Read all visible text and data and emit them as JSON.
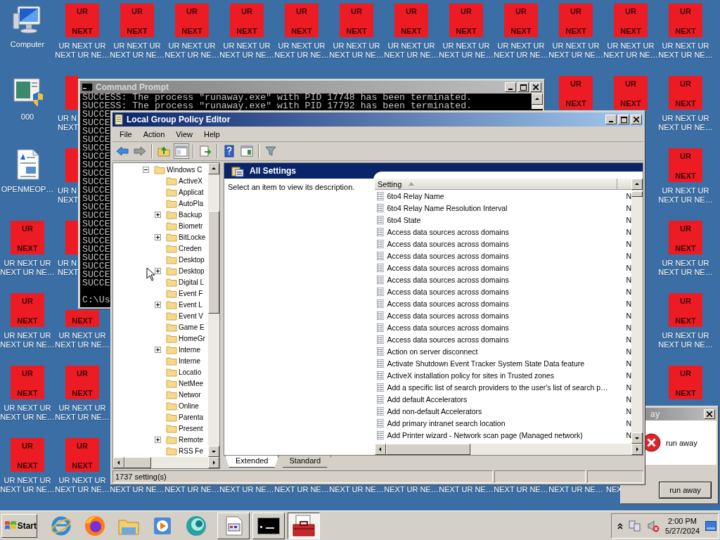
{
  "desktop": {
    "columns": [
      {
        "icons": [
          {
            "kind": "computer",
            "label": {
              "first": "Computer"
            }
          },
          {
            "kind": "panel",
            "label": {
              "first": "000"
            }
          },
          {
            "kind": "document",
            "label": {
              "first": "OPENMEOP…"
            }
          },
          {
            "kind": "tile",
            "tile": {
              "top": "UR",
              "bottom": "NEXT"
            },
            "label": {
              "first": "UR NEXT UR",
              "second": "NEXT UR NE…"
            }
          },
          {
            "kind": "tile",
            "tile": {
              "top": "UR",
              "bottom": "NEXT"
            },
            "label": {
              "first": "UR NEXT UR",
              "second": "NEXT UR NE…"
            }
          },
          {
            "kind": "tile",
            "tile": {
              "top": "UR",
              "bottom": "NEXT"
            },
            "label": {
              "first": "UR NEXT UR",
              "second": "NEXT UR NE…"
            }
          },
          {
            "kind": "tile",
            "tile": {
              "top": "UR",
              "bottom": "NEXT"
            },
            "label": {
              "first": "UR NEXT UR",
              "second": "NEXT UR NE…"
            }
          }
        ]
      },
      {
        "icons": [
          {
            "kind": "tile",
            "tile": {
              "top": "UR",
              "bottom": "NEXT"
            },
            "label": {
              "first": "UR NEXT UR",
              "second": "NEXT UR NE…"
            }
          },
          {
            "kind": "tile_sliver",
            "label": {
              "first": "UR N",
              "second": "NEXT"
            }
          },
          {
            "kind": "tile_sliver",
            "label": {
              "first": "UR N",
              "second": "NEXT"
            }
          },
          {
            "kind": "tile_sliver",
            "label": {
              "first": "UR N",
              "second": "NEXT"
            }
          },
          {
            "kind": "tile",
            "tile": {
              "bottom": "NEXT"
            },
            "label": {
              "first": "UR NEXT UR",
              "second": "NEXT UR NE…"
            }
          },
          {
            "kind": "tile",
            "tile": {
              "top": "UR",
              "bottom": "NEXT"
            },
            "label": {
              "first": "UR NEXT UR",
              "second": "NEXT UR NE…"
            }
          },
          {
            "kind": "tile",
            "tile": {
              "top": "UR",
              "bottom": "NEXT"
            },
            "label": {
              "first": "UR NEXT UR",
              "second": "NEXT UR NE…"
            }
          }
        ]
      },
      {
        "icons": [
          {
            "kind": "tile",
            "tile": {
              "top": "UR",
              "bottom": "NEXT"
            },
            "label": {
              "first": "UR NEXT UR",
              "second": "NEXT UR NE…"
            }
          },
          {
            "kind": "covered"
          },
          {
            "kind": "covered"
          },
          {
            "kind": "covered"
          },
          {
            "kind": "covered"
          },
          {
            "kind": "covered"
          },
          {
            "kind": "label_only",
            "label": {
              "second": "NEXT UR NE…"
            }
          }
        ]
      },
      {
        "icons": [
          {
            "kind": "tile",
            "tile": {
              "top": "UR",
              "bottom": "NEXT"
            },
            "label": {
              "first": "UR NEXT UR",
              "second": "NEXT UR NE…"
            }
          },
          {
            "kind": "covered"
          },
          {
            "kind": "covered"
          },
          {
            "kind": "covered"
          },
          {
            "kind": "covered"
          },
          {
            "kind": "covered"
          },
          {
            "kind": "label_only",
            "label": {
              "second": "NEXT UR NE…"
            }
          }
        ]
      },
      {
        "icons": [
          {
            "kind": "tile",
            "tile": {
              "top": "UR",
              "bottom": "NEXT"
            },
            "label": {
              "first": "UR NEXT UR",
              "second": "NEXT UR NE…"
            }
          },
          {
            "kind": "covered"
          },
          {
            "kind": "covered"
          },
          {
            "kind": "covered"
          },
          {
            "kind": "covered"
          },
          {
            "kind": "covered"
          },
          {
            "kind": "label_only",
            "label": {
              "second": "NEXT UR NE…"
            }
          }
        ]
      },
      {
        "icons": [
          {
            "kind": "tile",
            "tile": {
              "top": "UR",
              "bottom": "NEXT"
            },
            "label": {
              "first": "UR NEXT UR",
              "second": "NEXT UR NE…"
            }
          },
          {
            "kind": "covered"
          },
          {
            "kind": "covered"
          },
          {
            "kind": "covered"
          },
          {
            "kind": "covered"
          },
          {
            "kind": "covered"
          },
          {
            "kind": "label_only",
            "label": {
              "second": "NEXT UR NE…"
            }
          }
        ]
      },
      {
        "icons": [
          {
            "kind": "tile",
            "tile": {
              "top": "UR",
              "bottom": "NEXT"
            },
            "label": {
              "first": "UR NEXT UR",
              "second": "NEXT UR NE…"
            }
          },
          {
            "kind": "covered"
          },
          {
            "kind": "covered"
          },
          {
            "kind": "covered"
          },
          {
            "kind": "covered"
          },
          {
            "kind": "covered"
          },
          {
            "kind": "label_only",
            "label": {
              "second": "NEXT UR NE…"
            }
          }
        ]
      },
      {
        "icons": [
          {
            "kind": "tile",
            "tile": {
              "top": "UR",
              "bottom": "NEXT"
            },
            "label": {
              "first": "UR NEXT UR",
              "second": "NEXT UR NE…"
            }
          },
          {
            "kind": "covered"
          },
          {
            "kind": "covered"
          },
          {
            "kind": "covered"
          },
          {
            "kind": "covered"
          },
          {
            "kind": "covered"
          },
          {
            "kind": "label_only",
            "label": {
              "second": "NEXT UR NE…"
            }
          }
        ]
      },
      {
        "icons": [
          {
            "kind": "tile",
            "tile": {
              "top": "UR",
              "bottom": "NEXT"
            },
            "label": {
              "first": "UR NEXT UR",
              "second": "NEXT UR NE…"
            }
          },
          {
            "kind": "covered"
          },
          {
            "kind": "covered"
          },
          {
            "kind": "covered"
          },
          {
            "kind": "covered"
          },
          {
            "kind": "covered"
          },
          {
            "kind": "label_only",
            "label": {
              "second": "NEXT UR NE…"
            }
          }
        ]
      },
      {
        "icons": [
          {
            "kind": "tile",
            "tile": {
              "top": "UR",
              "bottom": "NEXT"
            },
            "label": {
              "first": "UR NEXT UR",
              "second": "NEXT UR NE…"
            }
          },
          {
            "kind": "covered"
          },
          {
            "kind": "covered"
          },
          {
            "kind": "covered"
          },
          {
            "kind": "covered"
          },
          {
            "kind": "covered"
          },
          {
            "kind": "label_only",
            "label": {
              "second": "NEXT UR NE…"
            }
          }
        ]
      },
      {
        "icons": [
          {
            "kind": "tile",
            "tile": {
              "top": "UR",
              "bottom": "NEXT"
            },
            "label": {
              "first": "UR NEXT UR",
              "second": "NEXT UR NE…"
            }
          },
          {
            "kind": "tile",
            "tile": {
              "top": "UR",
              "bottom": "NEXT"
            }
          },
          {
            "kind": "covered"
          },
          {
            "kind": "covered"
          },
          {
            "kind": "covered"
          },
          {
            "kind": "covered"
          },
          {
            "kind": "label_only",
            "label": {
              "second": "NEXT UR NE…"
            }
          }
        ]
      },
      {
        "icons": [
          {
            "kind": "tile",
            "tile": {
              "top": "UR",
              "bottom": "NEXT"
            },
            "label": {
              "first": "UR NEXT UR",
              "second": "NEXT UR NE…"
            }
          },
          {
            "kind": "tile",
            "tile": {
              "top": "UR",
              "bottom": "NEXT"
            }
          },
          {
            "kind": "covered"
          },
          {
            "kind": "covered"
          },
          {
            "kind": "covered"
          },
          {
            "kind": "covered"
          },
          {
            "kind": "label_tail",
            "label": {
              "second": "NEX"
            }
          }
        ]
      },
      {
        "icons": [
          {
            "kind": "tile",
            "tile": {
              "top": "UR",
              "bottom": "NEXT"
            },
            "label": {
              "first": "UR NEXT UR",
              "second": "NEXT UR NE…"
            }
          },
          {
            "kind": "tile",
            "tile": {
              "top": "UR",
              "bottom": "NEXT"
            },
            "label": {
              "first": "UR NEXT UR",
              "second": "NEXT UR NE…"
            }
          },
          {
            "kind": "tile",
            "tile": {
              "top": "UR",
              "bottom": "NEXT"
            },
            "label": {
              "first": "UR NEXT UR",
              "second": "NEXT UR NE…"
            }
          },
          {
            "kind": "tile",
            "tile": {
              "top": "UR",
              "bottom": "NEXT"
            },
            "label": {
              "first": "UR NEXT UR",
              "second": "NEXT UR NE…"
            }
          },
          {
            "kind": "tile",
            "tile": {
              "top": "UR",
              "bottom": "NEXT"
            },
            "label": {
              "first": "UR NEXT UR",
              "second": "NEXT UR NE…"
            }
          },
          {
            "kind": "tile",
            "tile": {
              "top": "UR",
              "bottom": "NEXT"
            }
          },
          {
            "kind": "covered"
          }
        ]
      }
    ]
  },
  "command_prompt": {
    "title": "Command Prompt",
    "lines": [
      "SUCCESS: The process \"runaway.exe\" with PID 17748 has been terminated.",
      "SUCCESS: The process \"runaway.exe\" with PID 17792 has been terminated.",
      "SUCCE",
      "SUCCE",
      "SUCCE",
      "SUCCE",
      "SUCCE",
      "SUCCE",
      "SUCCE",
      "SUCCE",
      "SUCCE",
      "SUCCE",
      "SUCCE",
      "SUCCE",
      "SUCCE",
      "SUCCE",
      "SUCCE",
      "SUCCE",
      "SUCCE",
      "SUCCE",
      "SUCCE",
      "SUCCE",
      "SUCCE"
    ],
    "prompt": "C:\\Us"
  },
  "group_policy_editor": {
    "title": "Local Group Policy Editor",
    "menu": [
      "File",
      "Action",
      "View",
      "Help"
    ],
    "tree": [
      {
        "label": "Windows C",
        "expandable": true,
        "expanded": true,
        "children": [
          {
            "label": "ActiveX",
            "expandable": false
          },
          {
            "label": "Applicat",
            "expandable": false
          },
          {
            "label": "AutoPla",
            "expandable": false
          },
          {
            "label": "Backup",
            "expandable": true,
            "expanded": false
          },
          {
            "label": "Biometr",
            "expandable": false
          },
          {
            "label": "BitLocke",
            "expandable": true,
            "expanded": false
          },
          {
            "label": "Creden",
            "expandable": false
          },
          {
            "label": "Desktop",
            "expandable": false
          },
          {
            "label": "Desktop",
            "expandable": true,
            "expanded": false
          },
          {
            "label": "Digital L",
            "expandable": false
          },
          {
            "label": "Event F",
            "expandable": false
          },
          {
            "label": "Event L",
            "expandable": true,
            "expanded": false
          },
          {
            "label": "Event V",
            "expandable": false
          },
          {
            "label": "Game E",
            "expandable": false
          },
          {
            "label": "HomeGr",
            "expandable": false
          },
          {
            "label": "Interne",
            "expandable": true,
            "expanded": false
          },
          {
            "label": "Interne",
            "expandable": false
          },
          {
            "label": "Locatio",
            "expandable": false
          },
          {
            "label": "NetMee",
            "expandable": false
          },
          {
            "label": "Networ",
            "expandable": false
          },
          {
            "label": "Online",
            "expandable": false
          },
          {
            "label": "Parenta",
            "expandable": false
          },
          {
            "label": "Present",
            "expandable": false
          },
          {
            "label": "Remote",
            "expandable": true,
            "expanded": false
          },
          {
            "label": "RSS Fe",
            "expandable": false
          }
        ]
      }
    ],
    "pane_title": "All Settings",
    "description": "Select an item to view its description.",
    "table": {
      "columns": [
        {
          "label": "Setting",
          "sorted_ascending": true
        }
      ],
      "rows": [
        {
          "setting": "6to4 Relay Name",
          "column_2": "N"
        },
        {
          "setting": "6to4 Relay Name Resolution Interval",
          "column_2": "N"
        },
        {
          "setting": "6to4 State",
          "column_2": "N"
        },
        {
          "setting": "Access data sources across domains",
          "column_2": "N"
        },
        {
          "setting": "Access data sources across domains",
          "column_2": "N"
        },
        {
          "setting": "Access data sources across domains",
          "column_2": "N"
        },
        {
          "setting": "Access data sources across domains",
          "column_2": "N"
        },
        {
          "setting": "Access data sources across domains",
          "column_2": "N"
        },
        {
          "setting": "Access data sources across domains",
          "column_2": "N"
        },
        {
          "setting": "Access data sources across domains",
          "column_2": "N"
        },
        {
          "setting": "Access data sources across domains",
          "column_2": "N"
        },
        {
          "setting": "Access data sources across domains",
          "column_2": "N"
        },
        {
          "setting": "Access data sources across domains",
          "column_2": "N"
        },
        {
          "setting": "Action on server disconnect",
          "column_2": "N"
        },
        {
          "setting": "Activate Shutdown Event Tracker System State Data feature",
          "column_2": "N"
        },
        {
          "setting": "ActiveX installation policy for sites in Trusted zones",
          "column_2": "N"
        },
        {
          "setting": "Add a specific list of search providers to the user's list of search p…",
          "column_2": "N"
        },
        {
          "setting": "Add default Accelerators",
          "column_2": "N"
        },
        {
          "setting": "Add non-default Accelerators",
          "column_2": "N"
        },
        {
          "setting": "Add primary intranet search location",
          "column_2": "N"
        },
        {
          "setting": "Add Printer wizard - Network scan page (Managed network)",
          "column_2": "N"
        }
      ]
    },
    "tabs": [
      {
        "label": "Extended",
        "selected": true
      },
      {
        "label": "Standard",
        "selected": false
      }
    ],
    "status_bar": [
      "1737 setting(s)"
    ]
  },
  "dialog": {
    "title": "ay",
    "message": "run away",
    "button": "run away"
  },
  "taskbar": {
    "start": "Start",
    "quick_launch": [
      {
        "kind": "ie"
      },
      {
        "kind": "firefox"
      },
      {
        "kind": "explorer"
      },
      {
        "kind": "media"
      },
      {
        "kind": "globe"
      }
    ],
    "tasks": [
      {
        "kind": "document",
        "selected": false
      },
      {
        "kind": "console",
        "selected": false
      },
      {
        "kind": "toolbox",
        "selected": true
      }
    ],
    "clock": {
      "time": "2:00 PM",
      "date": "5/27/2024"
    }
  }
}
